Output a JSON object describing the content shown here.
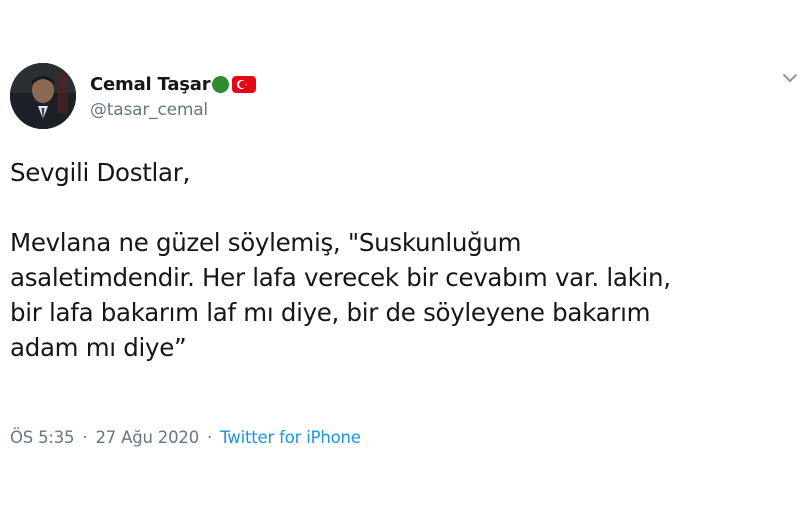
{
  "user": {
    "display_name": "Cemal Taşar",
    "handle": "@tasar_cemal"
  },
  "badges": {
    "dot_color": "#2e8b2e",
    "flag_color": "#e30a17"
  },
  "icons": {
    "menu": "chevron-down-icon"
  },
  "tweet": {
    "greeting": "Sevgili Dostlar,",
    "lines": [
      "Mevlana ne güzel söylemiş, \"Suskunluğum",
      "asaletimdendir. Her lafa verecek bir cevabım var. lakin,",
      "bir lafa bakarım laf mı diye, bir de söyleyene bakarım",
      "adam mı diye”"
    ]
  },
  "meta": {
    "time": "ÖS 5:35",
    "separator": "·",
    "date": "27 Ağu 2020",
    "source": "Twitter for iPhone"
  }
}
